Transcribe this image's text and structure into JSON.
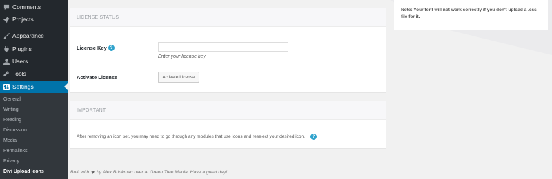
{
  "sidebar": {
    "items": [
      {
        "label": "Comments",
        "icon": "comments-icon"
      },
      {
        "label": "Projects",
        "icon": "pin-icon"
      },
      {
        "label": "Appearance",
        "icon": "brush-icon"
      },
      {
        "label": "Plugins",
        "icon": "plug-icon"
      },
      {
        "label": "Users",
        "icon": "user-icon"
      },
      {
        "label": "Tools",
        "icon": "wrench-icon"
      },
      {
        "label": "Settings",
        "icon": "settings-icon"
      }
    ],
    "submenu": [
      "General",
      "Writing",
      "Reading",
      "Discussion",
      "Media",
      "Permalinks",
      "Privacy",
      "Divi Upload Icons"
    ]
  },
  "license_card": {
    "heading": "LICENSE STATUS",
    "license_key_label": "License Key",
    "license_key_value": "",
    "input_description": "Enter your license key",
    "activate_label": "Activate License",
    "activate_button": "Activate License"
  },
  "important_card": {
    "heading": "IMPORTANT",
    "text": "After removing an icon set, you may need to go through any modules that use icons and reselect your desired icon."
  },
  "footer": {
    "prefix": "Built with",
    "suffix": "by Alex Brinkman over at Green Tree Media. Have a great day!"
  },
  "note": {
    "text": "Note: Your font will not work correctly if you don't upload a .css file for it."
  },
  "colors": {
    "sidebar_bg": "#23282d",
    "submenu_bg": "#32373c",
    "active_bg": "#0073aa",
    "help_badge": "#2ea2cc"
  }
}
